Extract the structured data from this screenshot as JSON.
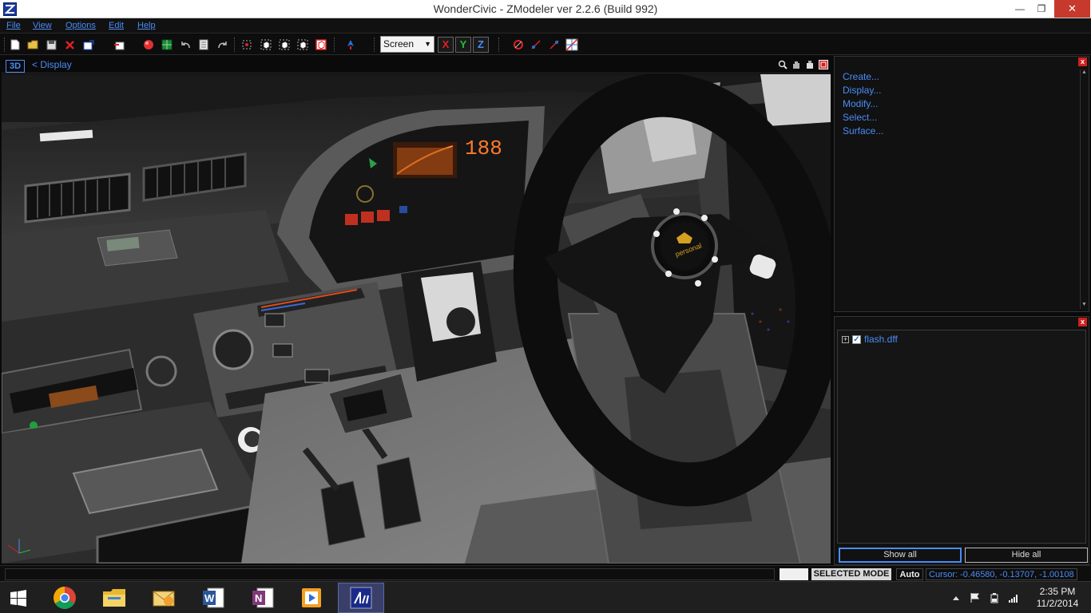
{
  "window": {
    "title": "WonderCivic - ZModeler ver 2.2.6 (Build 992)",
    "minimize_label": "—",
    "maximize_label": "❐",
    "close_label": "✕"
  },
  "menu": {
    "items": [
      "File",
      "View",
      "Options",
      "Edit",
      "Help"
    ]
  },
  "toolbar": {
    "screen_select": "Screen",
    "axis_x": "X",
    "axis_y": "Y",
    "axis_z": "Z",
    "icons": [
      "new-file-icon",
      "open-file-icon",
      "save-icon",
      "delete-icon",
      "import-icon",
      "export-icon",
      "render-sphere-icon",
      "texture-icon",
      "undo-icon",
      "notes-icon",
      "redo-icon",
      "select-vertex-icon",
      "select-object-icon",
      "select-box-icon",
      "select-mesh-icon",
      "select-invert-icon",
      "pivot-arrow-icon",
      "snap-icon",
      "link-icon",
      "unlink-icon",
      "cross-icon",
      "grid-icon"
    ]
  },
  "viewport": {
    "mode_badge": "3D",
    "breadcrumb": "< Display",
    "axis_x": "x",
    "axis_z": "z"
  },
  "command_panel": {
    "items": [
      "Create...",
      "Display...",
      "Modify...",
      "Select...",
      "Surface..."
    ],
    "close_label": "x"
  },
  "scene_tree": {
    "items": [
      {
        "label": "flash.dff",
        "checked": true
      }
    ],
    "show_all": "Show all",
    "hide_all": "Hide all",
    "close_label": "x"
  },
  "status": {
    "mode": "SELECTED MODE",
    "auto": "Auto",
    "cursor": "Cursor: -0.46580, -0.13707, -1.00108"
  },
  "taskbar": {
    "apps": [
      "chrome-icon",
      "file-explorer-icon",
      "outlook-icon",
      "word-icon",
      "onenote-icon",
      "media-player-icon",
      "asus-ai-icon"
    ],
    "time": "2:35 PM",
    "date": "11/2/2014"
  },
  "colors": {
    "accent": "#4a8cf7",
    "close_red": "#c7392d"
  }
}
